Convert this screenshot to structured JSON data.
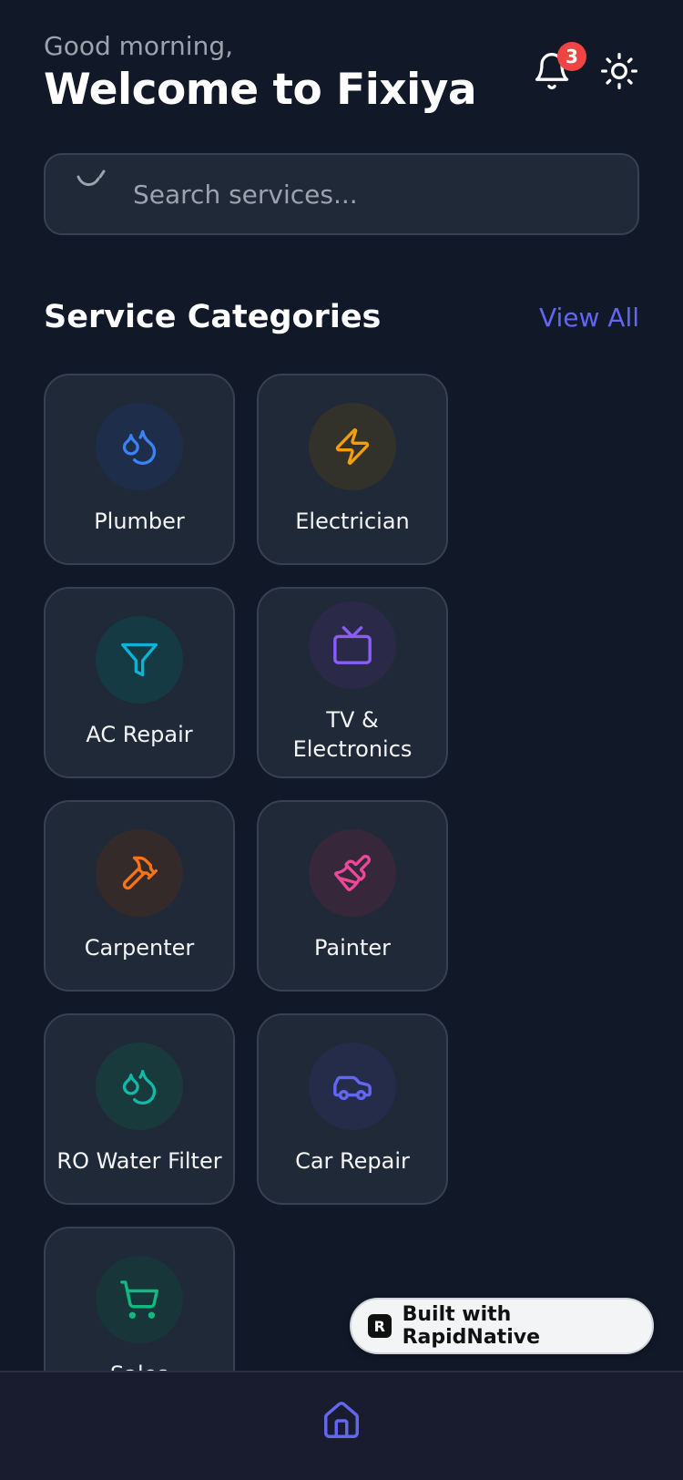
{
  "header": {
    "greeting": "Good morning,",
    "title": "Welcome to Fixiya",
    "notification_count": "3"
  },
  "search": {
    "placeholder": "Search services..."
  },
  "categories_section": {
    "title": "Service Categories",
    "view_all": "View All"
  },
  "categories": [
    {
      "label": "Plumber",
      "icon": "water-drop-icon",
      "color": "#3b82f6"
    },
    {
      "label": "Electrician",
      "icon": "lightning-icon",
      "color": "#f59e0b"
    },
    {
      "label": "AC Repair",
      "icon": "filter-icon",
      "color": "#06b6d4"
    },
    {
      "label": "TV & Electronics",
      "icon": "tv-icon",
      "color": "#8b5cf6"
    },
    {
      "label": "Carpenter",
      "icon": "hammer-icon",
      "color": "#f97316"
    },
    {
      "label": "Painter",
      "icon": "paintbrush-icon",
      "color": "#ec4899"
    },
    {
      "label": "RO Water Filter",
      "icon": "water-drop-icon",
      "color": "#14b8a6"
    },
    {
      "label": "Car Repair",
      "icon": "car-icon",
      "color": "#6366f1"
    },
    {
      "label": "Sales",
      "icon": "cart-icon",
      "color": "#10b981"
    }
  ],
  "badge": {
    "text": "Built with RapidNative"
  },
  "nav": {
    "home_icon": "home-icon"
  },
  "colors": {
    "background": "#111827",
    "card": "#1f2937",
    "accent": "#6366f1",
    "notification": "#ef4444"
  }
}
